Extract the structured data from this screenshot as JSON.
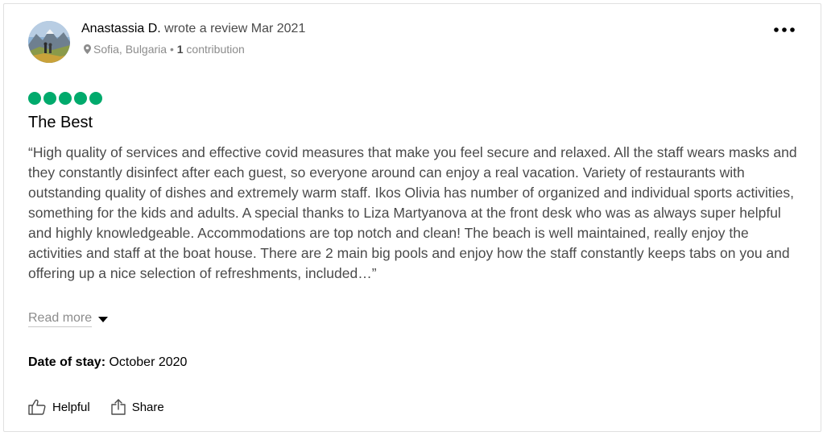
{
  "review": {
    "author": "Anastassia D.",
    "action_text": " wrote a review Mar 2021",
    "location": "Sofia, Bulgaria",
    "separator": " • ",
    "contributions_count": "1",
    "contributions_label": " contribution",
    "rating": 5,
    "rating_max": 5,
    "title": "The Best",
    "body": "“High quality of services and effective covid measures that make you feel secure and relaxed. All the staff wears masks and they constantly disinfect after each guest, so everyone around can enjoy a real vacation. Variety of restaurants with outstanding quality of dishes and extremely warm staff. Ikos Olivia has number of organized and individual sports activities, something for the kids and adults. A special thanks to Liza Martyanova at the front desk who was as always super helpful and highly knowledgeable. Accommodations are top notch and clean! The beach is well maintained, really enjoy the activities and staff at the boat house. There are 2 main big pools and enjoy how the staff constantly keeps tabs on you and offering up a nice selection of refreshments, included…”",
    "read_more_label": "Read more",
    "date_of_stay_label": "Date of stay:",
    "date_of_stay_value": " October 2020"
  },
  "actions": {
    "helpful_label": "Helpful",
    "share_label": "Share"
  },
  "icons": {
    "more": "more-horizontal-icon",
    "location": "map-pin-icon",
    "read_more": "caret-down-icon",
    "helpful": "thumbs-up-icon",
    "share": "share-icon"
  },
  "colors": {
    "rating_bubble": "#00aa6c",
    "primary_text": "#000000",
    "secondary_text": "#4a4a4a",
    "muted_text": "#8c8c8c"
  }
}
